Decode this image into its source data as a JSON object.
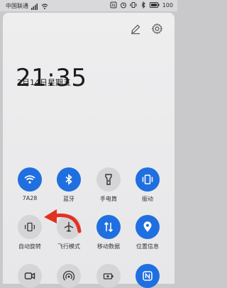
{
  "status_bar": {
    "carrier": "中国联通",
    "battery": "100"
  },
  "clock": {
    "time": "21:35",
    "date": "2月14日星期五"
  },
  "tiles": [
    {
      "label": "7A28",
      "icon": "wifi-icon",
      "state": "on"
    },
    {
      "label": "蓝牙",
      "icon": "bluetooth-icon",
      "state": "on"
    },
    {
      "label": "手电筒",
      "icon": "flashlight-icon",
      "state": "off"
    },
    {
      "label": "振动",
      "icon": "vibrate-icon",
      "state": "on"
    },
    {
      "label": "自动旋转",
      "icon": "auto-rotate-icon",
      "state": "off"
    },
    {
      "label": "飞行模式",
      "icon": "airplane-icon",
      "state": "off"
    },
    {
      "label": "移动数据",
      "icon": "mobile-data-icon",
      "state": "on"
    },
    {
      "label": "位置信息",
      "icon": "location-icon",
      "state": "on"
    }
  ],
  "colors": {
    "accent": "#1f6fe0",
    "arrow": "#e2321f"
  }
}
